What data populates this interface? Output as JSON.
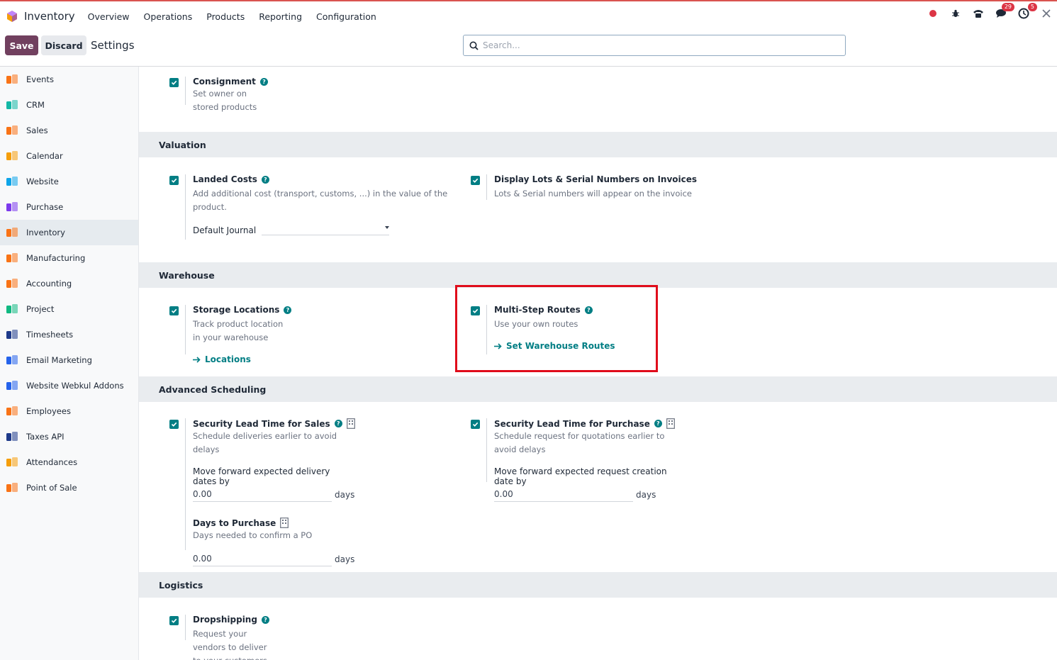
{
  "navbar": {
    "app_name": "Inventory",
    "menu": [
      "Overview",
      "Operations",
      "Products",
      "Reporting",
      "Configuration"
    ],
    "badges": {
      "messages": "29",
      "activities": "5"
    }
  },
  "control": {
    "save_label": "Save",
    "discard_label": "Discard",
    "title": "Settings",
    "search_placeholder": "Search..."
  },
  "sidebar": {
    "items": [
      {
        "label": "Events",
        "icon": "events-icon",
        "color": "#f97316"
      },
      {
        "label": "CRM",
        "icon": "crm-icon",
        "color": "#14b8a6"
      },
      {
        "label": "Sales",
        "icon": "sales-icon",
        "color": "#f97316"
      },
      {
        "label": "Calendar",
        "icon": "calendar-icon",
        "color": "#f59e0b"
      },
      {
        "label": "Website",
        "icon": "website-icon",
        "color": "#0ea5e9"
      },
      {
        "label": "Purchase",
        "icon": "purchase-icon",
        "color": "#7c3aed"
      },
      {
        "label": "Inventory",
        "icon": "inventory-icon",
        "color": "#f97316"
      },
      {
        "label": "Manufacturing",
        "icon": "manufacturing-icon",
        "color": "#f97316"
      },
      {
        "label": "Accounting",
        "icon": "accounting-icon",
        "color": "#f97316"
      },
      {
        "label": "Project",
        "icon": "project-icon",
        "color": "#10b981"
      },
      {
        "label": "Timesheets",
        "icon": "timesheets-icon",
        "color": "#1e3a8a"
      },
      {
        "label": "Email Marketing",
        "icon": "email-marketing-icon",
        "color": "#2563eb"
      },
      {
        "label": "Website Webkul Addons",
        "icon": "webkul-icon",
        "color": "#2563eb"
      },
      {
        "label": "Employees",
        "icon": "employees-icon",
        "color": "#f97316"
      },
      {
        "label": "Taxes API",
        "icon": "taxes-api-icon",
        "color": "#1e3a8a"
      },
      {
        "label": "Attendances",
        "icon": "attendances-icon",
        "color": "#f59e0b"
      },
      {
        "label": "Point of Sale",
        "icon": "pos-icon",
        "color": "#f97316"
      }
    ]
  },
  "sections": {
    "valuation": "Valuation",
    "warehouse": "Warehouse",
    "advanced_scheduling": "Advanced Scheduling",
    "logistics": "Logistics"
  },
  "settings": {
    "consignment": {
      "title": "Consignment",
      "desc": "Set owner on stored products"
    },
    "landed_costs": {
      "title": "Landed Costs",
      "desc": "Add additional cost (transport, customs, ...) in the value of the product.",
      "sub_label": "Default Journal"
    },
    "lots_invoices": {
      "title": "Display Lots & Serial Numbers on Invoices",
      "desc": "Lots & Serial numbers will appear on the invoice"
    },
    "storage_locations": {
      "title": "Storage Locations",
      "desc": "Track product location in your warehouse",
      "link": "Locations"
    },
    "multi_step": {
      "title": "Multi-Step Routes",
      "desc": "Use your own routes",
      "link": "Set Warehouse Routes"
    },
    "lead_sales": {
      "title": "Security Lead Time for Sales",
      "desc": "Schedule deliveries earlier to avoid delays",
      "sub_label": "Move forward expected delivery dates by",
      "value": "0.00",
      "unit": "days"
    },
    "lead_purchase": {
      "title": "Security Lead Time for Purchase",
      "desc": "Schedule request for quotations earlier to avoid delays",
      "sub_label": "Move forward expected request creation date by",
      "value": "0.00",
      "unit": "days"
    },
    "days_purchase": {
      "title": "Days to Purchase",
      "desc": "Days needed to confirm a PO",
      "value": "0.00",
      "unit": "days"
    },
    "dropshipping": {
      "title": "Dropshipping",
      "desc": "Request your vendors to deliver to your customers"
    }
  },
  "colors": {
    "accent": "#017e84",
    "brand": "#71405f",
    "highlight": "#e00c1b"
  }
}
